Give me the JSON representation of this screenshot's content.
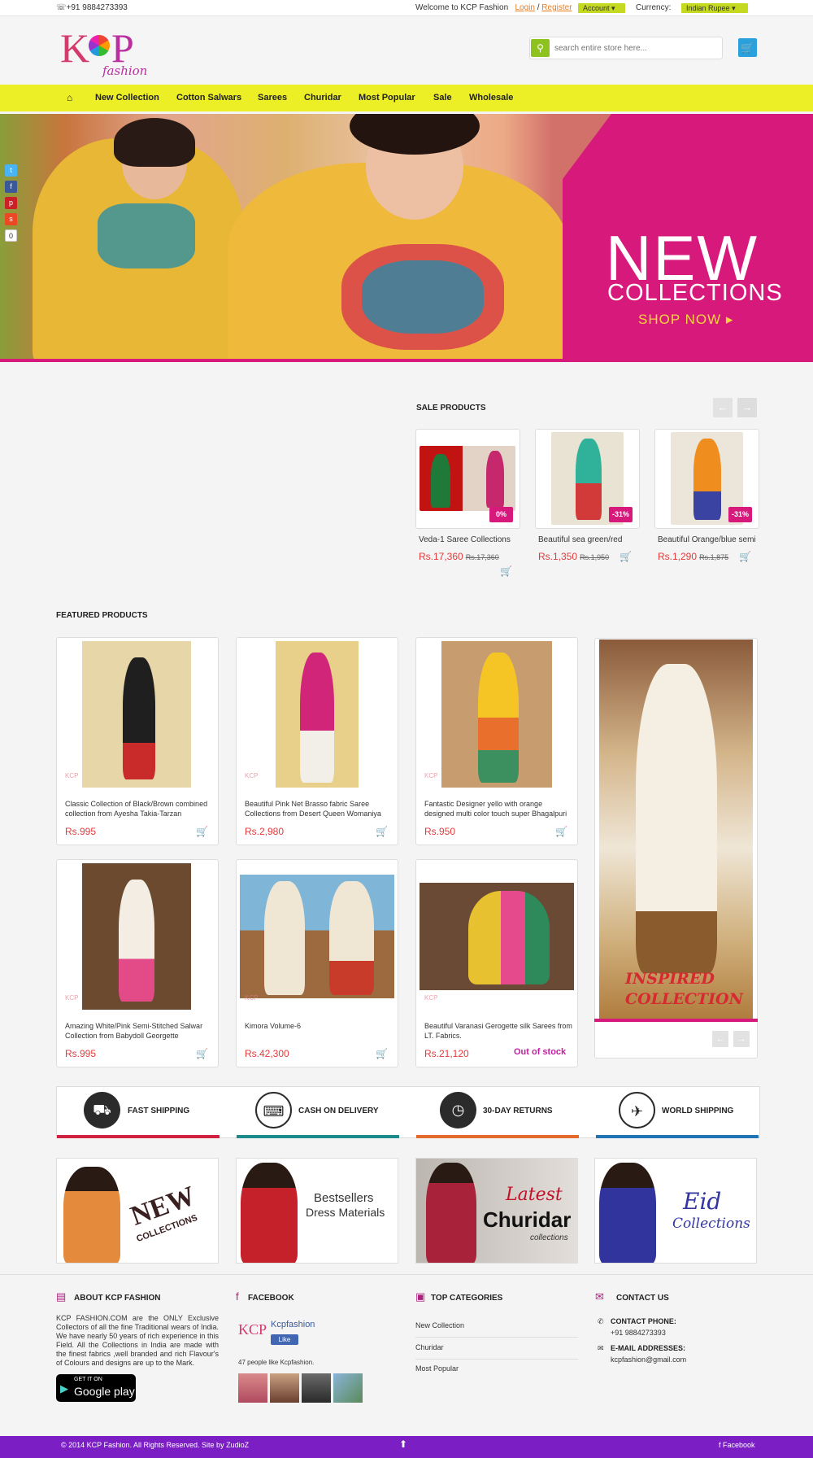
{
  "topbar": {
    "phone": "+91 9884273393",
    "welcome": "Welcome to KCP Fashion",
    "login": "Login",
    "separator": "/",
    "register": "Register",
    "account": "Account",
    "currency_label": "Currency:",
    "currency_value": "Indian Rupee"
  },
  "header": {
    "logo_main": "KCP",
    "logo_script": "fashion",
    "search_placeholder": "search entire store here..."
  },
  "nav": {
    "items": [
      "New Collection",
      "Cotton Salwars",
      "Sarees",
      "Churidar",
      "Most Popular",
      "Sale",
      "Wholesale"
    ]
  },
  "hero": {
    "headline": "NEW",
    "subheadline": "COLLECTIONS",
    "cta": "SHOP NOW ▸",
    "social_count": "0"
  },
  "sale": {
    "title": "SALE PRODUCTS",
    "items": [
      {
        "name": "Veda-1 Saree Collections",
        "price": "Rs.17,360",
        "old_price": "Rs.17,360",
        "badge": "0%"
      },
      {
        "name": "Beautiful sea green/red",
        "price": "Rs.1,350",
        "old_price": "Rs.1,950",
        "badge": "-31%"
      },
      {
        "name": "Beautiful Orange/blue semi",
        "price": "Rs.1,290",
        "old_price": "Rs.1,875",
        "badge": "-31%"
      }
    ]
  },
  "featured": {
    "title": "FEATURED PRODUCTS",
    "items": [
      {
        "name": "Classic Collection of Black/Brown combined collection from Ayesha Takia-Tarzan",
        "price": "Rs.995"
      },
      {
        "name": "Beautiful Pink Net Brasso fabric Saree Collections from Desert Queen Womaniya",
        "price": "Rs.2,980"
      },
      {
        "name": "Fantastic Designer yello with orange designed multi color touch super Bhagalpuri",
        "price": "Rs.950"
      },
      {
        "name": "Amazing White/Pink Semi-Stitched Salwar Collection from Babydoll Georgette",
        "price": "Rs.995"
      },
      {
        "name": "Kimora Volume-6",
        "price": "Rs.42,300"
      },
      {
        "name": "Beautiful Varanasi Gerogette silk Sarees from LT. Fabrics.",
        "price": "Rs.21,120"
      }
    ],
    "out_of_stock": "Out of stock",
    "inspired_line1": "INSPIRED",
    "inspired_line2": "COLLECTION"
  },
  "features": [
    {
      "label": "FAST SHIPPING",
      "color": "#d0213e"
    },
    {
      "label": "CASH ON DELIVERY",
      "color": "#1a8a8a"
    },
    {
      "label": "30-DAY RETURNS",
      "color": "#e36a2a"
    },
    {
      "label": "WORLD SHIPPING",
      "color": "#1f74b6"
    }
  ],
  "banners": {
    "b1_line1": "NEW",
    "b1_line2": "COLLECTIONS",
    "b2_line1": "Bestsellers",
    "b2_line2": "Dress Materials",
    "b3_line1": "Latest",
    "b3_line2": "Churidar",
    "b3_line3": "collections",
    "b4_line1": "Eid",
    "b4_line2": "Collections"
  },
  "footer": {
    "about_title": "ABOUT KCP FASHION",
    "about_text": "KCP FASHION.COM are the ONLY Exclusive Collectors of all the fine Traditional wears of India. We have nearly 50 years of rich experience in this Field. All the Collections in India are made with the finest fabrics ,well branded and rich Flavour's of Colours and designs are up to the Mark.",
    "gplay_small": "GET IT ON",
    "gplay_big": "Google play",
    "facebook_title": "FACEBOOK",
    "fb_page_name": "Kcpfashion",
    "fb_like": "Like",
    "fb_count": "47 people like Kcpfashion.",
    "categories_title": "TOP CATEGORIES",
    "categories": [
      "New Collection",
      "Churidar",
      "Most Popular"
    ],
    "contact_title": "CONTACT US",
    "contact_phone_label": "CONTACT PHONE:",
    "contact_phone": "+91 9884273393",
    "contact_email_label": "E-MAIL ADDRESSES:",
    "contact_email": "kcpfashion@gmail.com"
  },
  "bottombar": {
    "copyright": "© 2014 KCP Fashion. All Rights Reserved. Site by ZudioZ",
    "back_to_top": "⬆",
    "facebook": "Facebook"
  }
}
